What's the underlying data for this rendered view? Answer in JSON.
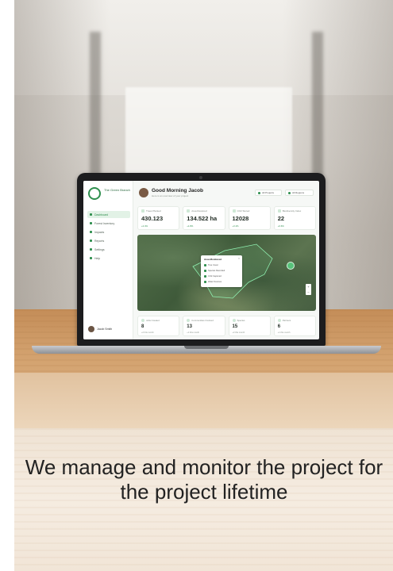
{
  "caption": "We manage and monitor the project for the project lifetime",
  "dashboard": {
    "brand": "The Green Branch",
    "nav": [
      "Dashboard",
      "Forest Inventory",
      "Impacts",
      "Reports",
      "Settings",
      "Help"
    ],
    "user": "Jacob Smith",
    "greeting": "Good Morning Jacob",
    "greeting_sub": "Here is an overview of your project",
    "filters": [
      "All Projects",
      "All Regions"
    ],
    "cards": [
      {
        "label": "Trees Planted",
        "value": "430.123",
        "foot": "+2.4%"
      },
      {
        "label": "Area Restored",
        "value": "134.522 ha",
        "foot": "+1.8%"
      },
      {
        "label": "CO2 Stored",
        "value": "12028",
        "foot": "+3.1%"
      },
      {
        "label": "Biodiversity Index",
        "value": "22",
        "foot": "+0.6%"
      }
    ],
    "map_popup": {
      "title": "Area Monitored",
      "rows": [
        "Tree Cover",
        "Species Recorded",
        "CO2 Captured",
        "Water Sources"
      ]
    },
    "stats": [
      {
        "label": "Jobs Created",
        "value": "8",
        "foot": "+2 this month"
      },
      {
        "label": "Communities Involved",
        "value": "13",
        "foot": "+1 this month"
      },
      {
        "label": "Species",
        "value": "15",
        "foot": "+3 this month"
      },
      {
        "label": "Partners",
        "value": "6",
        "foot": "+1 this month"
      }
    ]
  },
  "colors": {
    "accent": "#2f8f4e",
    "caption_text": "#222222"
  }
}
